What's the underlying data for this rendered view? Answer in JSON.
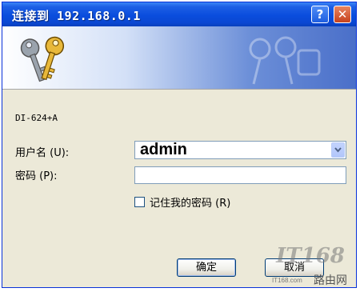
{
  "window": {
    "title": "连接到 192.168.0.1"
  },
  "titlebar": {
    "help_glyph": "?",
    "close_glyph": "✕"
  },
  "banner": {
    "icon": "keys-icon",
    "ghost_icon": "keys-watermark-icon"
  },
  "device_name": "DI-624+A",
  "form": {
    "username_label": "用户名 (U):",
    "username_value": "admin",
    "password_label": "密码 (P):",
    "password_value": "",
    "remember_label": "记住我的密码 (R)",
    "remember_checked": false
  },
  "buttons": {
    "ok": "确定",
    "cancel": "取消"
  },
  "watermark": {
    "logo_text": "IT168",
    "site_text": "IT168.com",
    "brand_text": "路由网"
  },
  "colors": {
    "titlebar": "#0a4ddd",
    "dialog_bg": "#ece9d8",
    "input_border": "#7f9db9"
  }
}
